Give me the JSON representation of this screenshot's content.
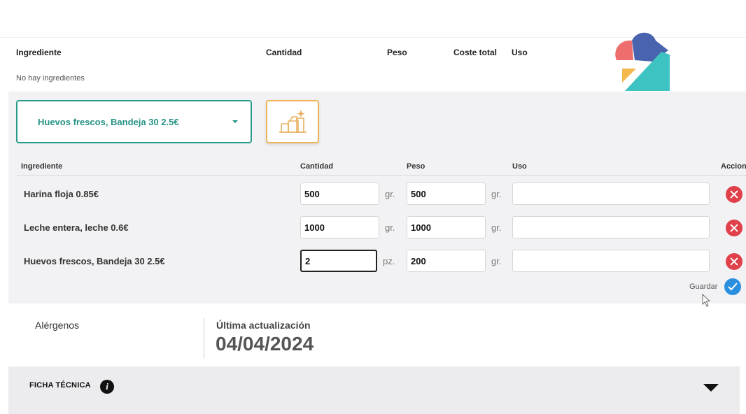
{
  "summary_table": {
    "headers": [
      "Ingrediente",
      "Cantidad",
      "Peso",
      "Coste total",
      "Uso"
    ],
    "empty_message": "No hay ingredientes"
  },
  "selector": {
    "selected": "Huevos frescos, Bandeja 30 2.5€",
    "add_icon": "basket-sparkle-icon"
  },
  "ingredients_table": {
    "headers": [
      "Ingrediente",
      "Cantidad",
      "Peso",
      "Uso",
      "Accion"
    ],
    "rows": [
      {
        "name": "Harina floja 0.85€",
        "quantity": "500",
        "quantity_unit": "gr.",
        "weight": "500",
        "weight_unit": "gr.",
        "use": ""
      },
      {
        "name": "Leche entera, leche 0.6€",
        "quantity": "1000",
        "quantity_unit": "gr.",
        "weight": "1000",
        "weight_unit": "gr.",
        "use": ""
      },
      {
        "name": "Huevos frescos, Bandeja 30 2.5€",
        "quantity": "2",
        "quantity_unit": "pz.",
        "weight": "200",
        "weight_unit": "gr.",
        "use": ""
      }
    ],
    "save_label": "Guardar"
  },
  "info": {
    "allergens_label": "Alérgenos",
    "last_update_label": "Última actualización",
    "last_update_date": "04/04/2024"
  },
  "ficha": {
    "title": "FICHA TÉCNICA"
  },
  "colors": {
    "accent_teal": "#249283",
    "accent_orange": "#f0b45a",
    "delete_red": "#e0404a",
    "save_blue": "#2b8fe0"
  }
}
